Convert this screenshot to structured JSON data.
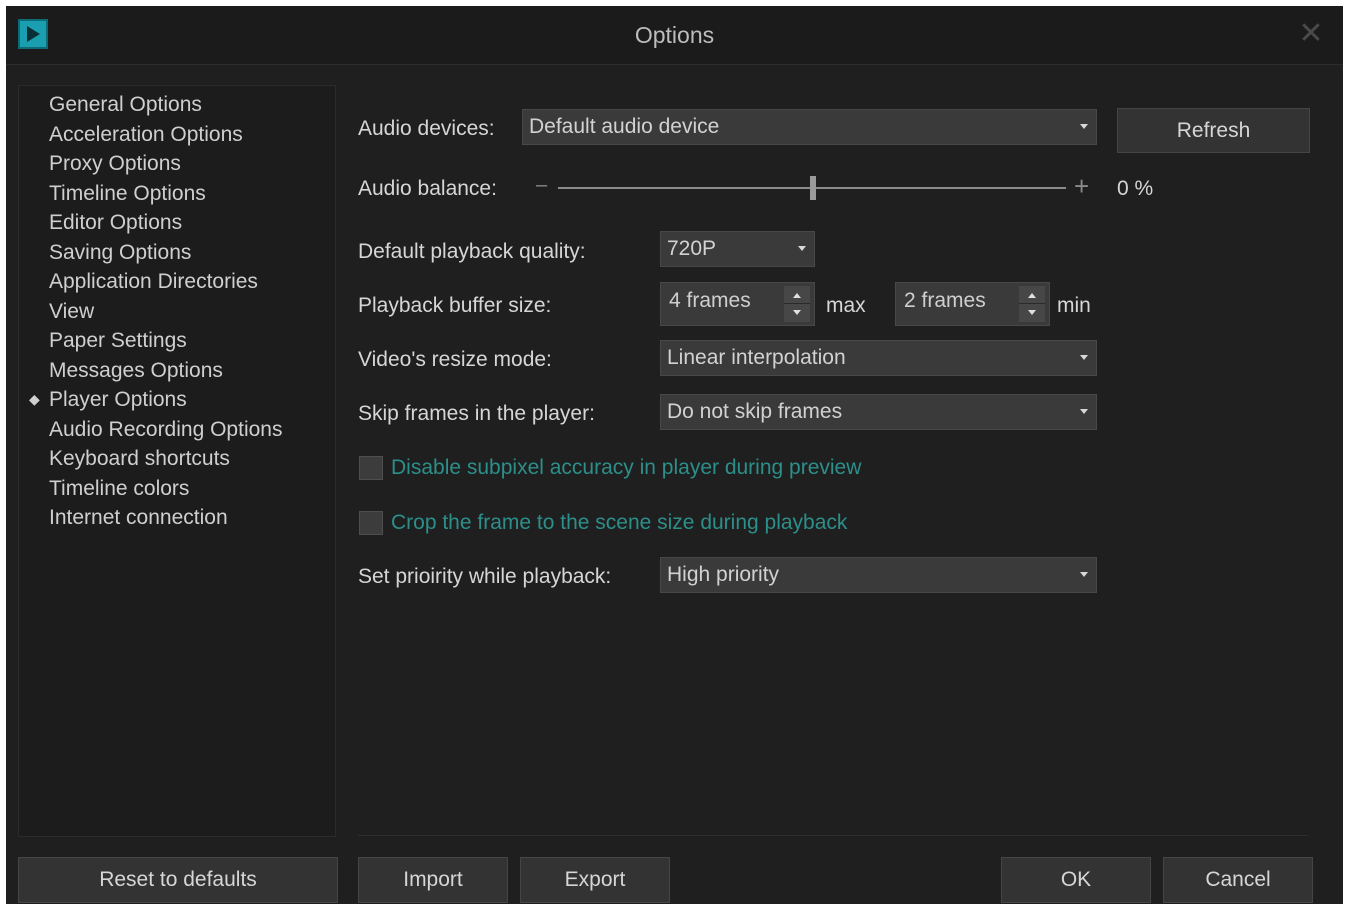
{
  "window": {
    "title": "Options",
    "app_icon": "play-icon",
    "close_symbol": "✕"
  },
  "sidebar": {
    "items": [
      {
        "label": "General Options"
      },
      {
        "label": "Acceleration Options"
      },
      {
        "label": "Proxy Options"
      },
      {
        "label": "Timeline Options"
      },
      {
        "label": "Editor Options"
      },
      {
        "label": "Saving Options"
      },
      {
        "label": "Application Directories"
      },
      {
        "label": "View"
      },
      {
        "label": "Paper Settings"
      },
      {
        "label": "Messages Options"
      },
      {
        "label": "Player Options",
        "selected": true
      },
      {
        "label": "Audio Recording Options"
      },
      {
        "label": "Keyboard shortcuts"
      },
      {
        "label": "Timeline colors"
      },
      {
        "label": "Internet connection"
      }
    ]
  },
  "player": {
    "audio_devices_label": "Audio devices:",
    "audio_devices_value": "Default audio device",
    "refresh_label": "Refresh",
    "audio_balance_label": "Audio balance:",
    "audio_balance_minus": "–",
    "audio_balance_plus": "+",
    "audio_balance_value": "0 %",
    "default_quality_label": "Default playback quality:",
    "default_quality_value": "720P",
    "buffer_size_label": "Playback buffer size:",
    "buffer_max_value": "4 frames",
    "buffer_max_suffix": "max",
    "buffer_min_value": "2 frames",
    "buffer_min_suffix": "min",
    "resize_mode_label": "Video's resize mode:",
    "resize_mode_value": "Linear interpolation",
    "skip_frames_label": "Skip frames in the player:",
    "skip_frames_value": "Do not skip frames",
    "subpixel_label": "Disable subpixel accuracy in player during preview",
    "subpixel_checked": false,
    "crop_label": "Crop the frame to the scene size during playback",
    "crop_checked": false,
    "priority_label": "Set prioirity while playback:",
    "priority_value": "High priority"
  },
  "footer": {
    "reset_label": "Reset to defaults",
    "import_label": "Import",
    "export_label": "Export",
    "ok_label": "OK",
    "cancel_label": "Cancel"
  },
  "colors": {
    "background": "#1f1f1f",
    "accent_teal": "#2c8f8a",
    "icon_teal": "#1a9fb0"
  }
}
